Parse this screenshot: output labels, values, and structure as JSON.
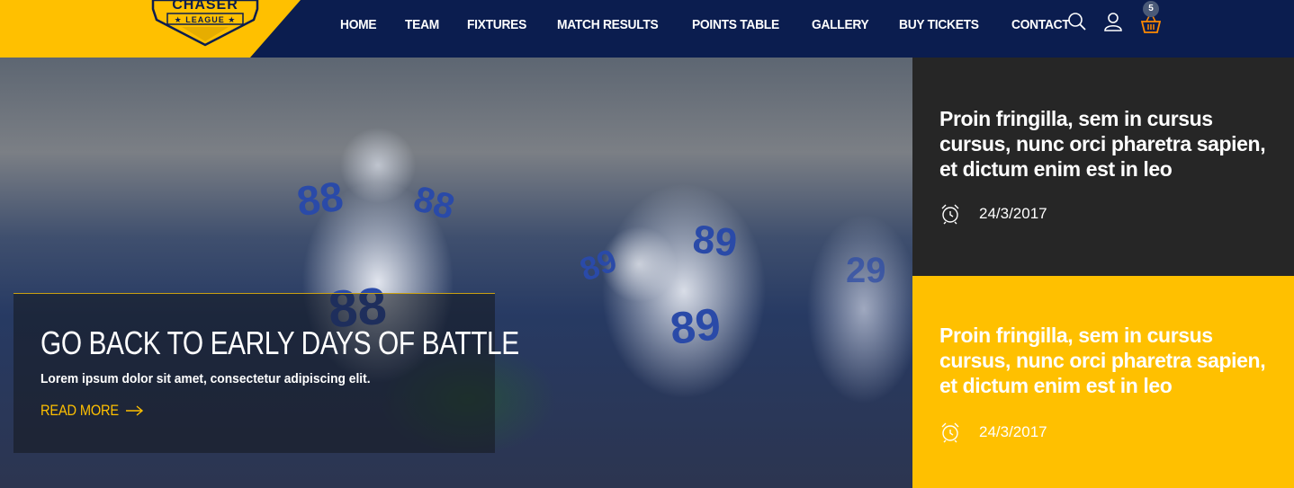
{
  "brand": {
    "name": "CHASER",
    "tagline": "LEAGUE"
  },
  "nav": {
    "items": [
      "HOME",
      "TEAM",
      "FIXTURES",
      "MATCH RESULTS",
      "POINTS TABLE",
      "GALLERY",
      "BUY TICKETS",
      "CONTACT"
    ]
  },
  "header_icons": {
    "search": "search-icon",
    "user": "user-icon",
    "cart": "basket-icon",
    "cart_count": "5"
  },
  "hero": {
    "title": "GO BACK TO EARLY DAYS OF BATTLE",
    "subtitle": "Lorem ipsum dolor sit amet, consectetur adipiscing elit.",
    "read_more": "READ MORE",
    "jersey_numbers": [
      "88",
      "89",
      "29"
    ]
  },
  "posts": [
    {
      "title": "Proin fringilla, sem in cursus cursus, nunc orci pharetra sapien, et dictum enim est in leo",
      "date": "24/3/2017"
    },
    {
      "title": "Proin fringilla, sem in cursus cursus, nunc orci pharetra sapien, et dictum enim est in leo",
      "date": "24/3/2017"
    }
  ],
  "colors": {
    "navy": "#0b1d4f",
    "accent": "#ffc000",
    "dark": "#262626"
  }
}
